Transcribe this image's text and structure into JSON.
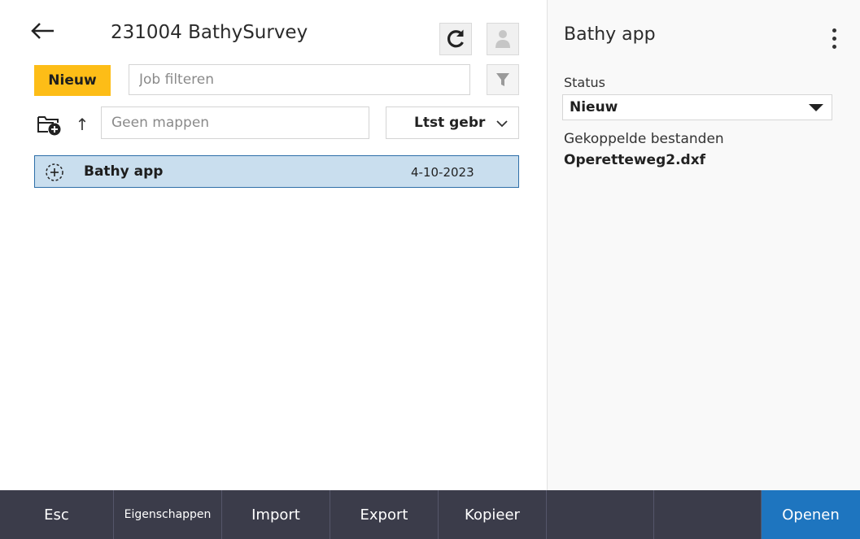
{
  "header": {
    "title": "231004 BathySurvey"
  },
  "actions": {
    "new_label": "Nieuw"
  },
  "filter": {
    "placeholder": "Job filteren"
  },
  "folder": {
    "placeholder": "Geen mappen",
    "up_symbol": "↑"
  },
  "sort": {
    "selected": "Ltst gebr"
  },
  "jobs": [
    {
      "name": "Bathy app",
      "date": "4-10-2023",
      "selected": true
    }
  ],
  "details": {
    "title": "Bathy app",
    "status_label": "Status",
    "status_value": "Nieuw",
    "linked_label": "Gekoppelde bestanden",
    "linked_file": "Operetteweg2.dxf"
  },
  "toolbar": {
    "buttons": [
      "Esc",
      "Eigenschappen",
      "Import",
      "Export",
      "Kopieer",
      "",
      "",
      "Openen"
    ]
  },
  "colors": {
    "accent_yellow": "#fdbd17",
    "selected_row": "#c9deee",
    "selected_border": "#2d6ea8",
    "toolbar_bg": "#3b3c4a",
    "primary_blue": "#1e75bf"
  },
  "icons": [
    "arrow-left-icon",
    "refresh-icon",
    "user-icon",
    "filter-icon",
    "folder-add-icon",
    "arrow-up-icon",
    "chevron-down-icon",
    "job-add-icon",
    "more-vertical-icon",
    "caret-down-icon"
  ]
}
